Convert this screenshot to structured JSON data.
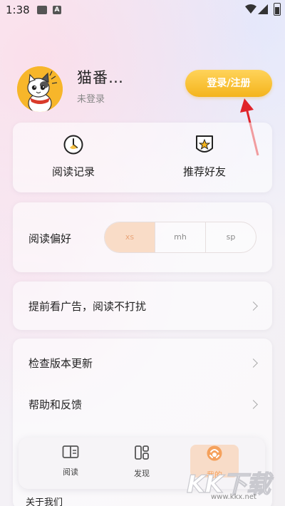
{
  "status_bar": {
    "time": "1:38"
  },
  "profile": {
    "username": "猫番…",
    "login_status": "未登录",
    "login_button": "登录/注册"
  },
  "quick_actions": {
    "reading_history": "阅读记录",
    "recommend_friends": "推荐好友"
  },
  "reading_preference": {
    "label": "阅读偏好",
    "options": [
      "xs",
      "mh",
      "sp"
    ],
    "selected": "xs"
  },
  "settings": {
    "ad_preview": "提前看广告，阅读不打扰",
    "check_update": "检查版本更新",
    "help_feedback": "帮助和反馈",
    "partial_row": "关于我们"
  },
  "bottom_nav": {
    "read": "阅读",
    "discover": "发现",
    "mine": "我的"
  },
  "watermark": {
    "text": "KK下载",
    "url": "www.kkx.net"
  },
  "colors": {
    "accent_yellow": "#f4b41c",
    "selected_pref_bg": "#f9dcc7",
    "arrow_red": "#e0242a"
  }
}
